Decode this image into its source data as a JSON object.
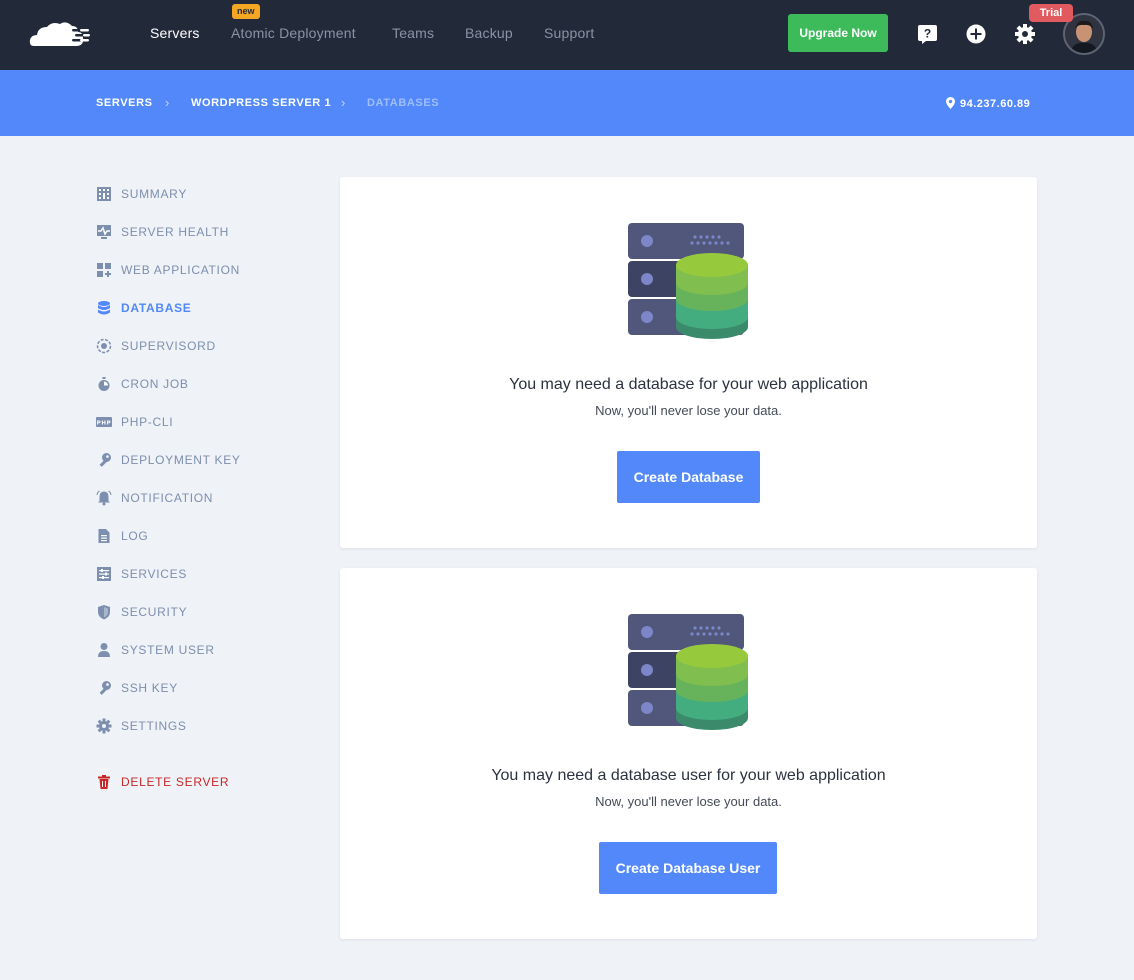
{
  "topnav": {
    "items": [
      {
        "label": "Servers",
        "active": true
      },
      {
        "label": "Atomic Deployment",
        "active": false
      },
      {
        "label": "Teams",
        "active": false
      },
      {
        "label": "Backup",
        "active": false
      },
      {
        "label": "Support",
        "active": false
      }
    ],
    "new_badge": "new",
    "upgrade_label": "Upgrade Now",
    "trial_badge": "Trial",
    "icons": [
      "help-icon",
      "add-icon",
      "gear-icon"
    ]
  },
  "breadcrumb": {
    "items": [
      "SERVERS",
      "WORDPRESS SERVER 1",
      "DATABASES"
    ],
    "ip": "94.237.60.89"
  },
  "sidebar": {
    "items": [
      {
        "label": "SUMMARY",
        "icon": "summary-icon"
      },
      {
        "label": "SERVER HEALTH",
        "icon": "health-icon"
      },
      {
        "label": "WEB APPLICATION",
        "icon": "web-app-icon"
      },
      {
        "label": "DATABASE",
        "icon": "database-icon",
        "active": true
      },
      {
        "label": "SUPERVISORD",
        "icon": "supervisord-icon"
      },
      {
        "label": "CRON JOB",
        "icon": "timer-icon"
      },
      {
        "label": "PHP-CLI",
        "icon": "php-icon"
      },
      {
        "label": "DEPLOYMENT KEY",
        "icon": "key-icon"
      },
      {
        "label": "NOTIFICATION",
        "icon": "bell-icon"
      },
      {
        "label": "LOG",
        "icon": "file-icon"
      },
      {
        "label": "SERVICES",
        "icon": "services-icon"
      },
      {
        "label": "SECURITY",
        "icon": "shield-icon"
      },
      {
        "label": "SYSTEM USER",
        "icon": "user-icon"
      },
      {
        "label": "SSH KEY",
        "icon": "key-icon"
      },
      {
        "label": "SETTINGS",
        "icon": "gear-icon"
      }
    ],
    "delete_label": "DELETE SERVER",
    "php_text": "PHP"
  },
  "cards": [
    {
      "title": "You may need a database for your web application",
      "subtitle": "Now, you'll never lose your data.",
      "button": "Create Database"
    },
    {
      "title": "You may need a database user for your web application",
      "subtitle": "Now, you'll never lose your data.",
      "button": "Create Database User"
    }
  ],
  "colors": {
    "topbar": "#222a3a",
    "accent": "#5288fa",
    "upgrade": "#3dbb5b",
    "trial": "#e05a60",
    "danger": "#c62828",
    "sidebar_text": "#7d8fae"
  }
}
